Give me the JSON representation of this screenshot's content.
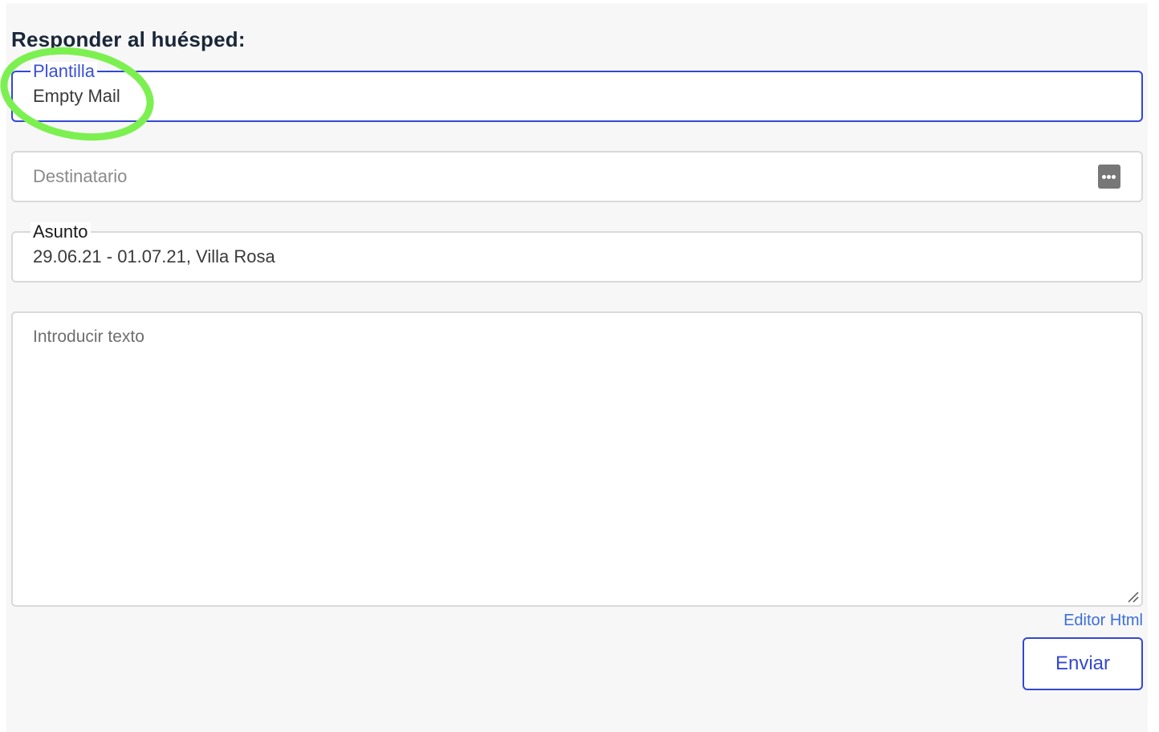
{
  "heading": "Responder al huésped:",
  "template_field": {
    "label": "Plantilla",
    "value": "Empty Mail"
  },
  "recipient_field": {
    "placeholder": "Destinatario",
    "icon": "more-dots-icon"
  },
  "subject_field": {
    "label": "Asunto",
    "value": "29.06.21 - 01.07.21, Villa Rosa"
  },
  "body_field": {
    "placeholder": "Introducir texto"
  },
  "editor_link": "Editor Html",
  "send_label": "Enviar",
  "colors": {
    "accent": "#3547d4",
    "link": "#3d6fd9",
    "highlight": "#7cf050",
    "heading": "#1a2738"
  }
}
